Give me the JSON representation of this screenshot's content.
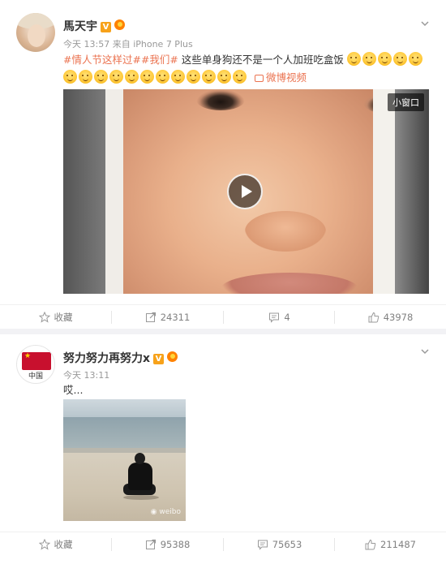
{
  "colors": {
    "topic": "#eb7350",
    "verified_badge": "#f7a21a",
    "meta_text": "#999999",
    "action_text": "#808080"
  },
  "posts": [
    {
      "author": "馬天宇",
      "verified_badge": "V",
      "meta": "今天 13:57 来自 iPhone 7 Plus",
      "topic1": "#情人节这样过#",
      "topic2": "#我们#",
      "text": "这些单身狗还不是一个人加班吃盒饭",
      "video_link": "微博视频",
      "mini_window": "小窗口",
      "actions": {
        "favorite": "收藏",
        "repost_count": "24311",
        "comment_count": "4",
        "like_count": "43978"
      }
    },
    {
      "author": "努力努力再努力x",
      "verified_badge": "V",
      "avatar_text": "中国",
      "meta": "今天 13:11",
      "text": "哎...",
      "actions": {
        "favorite": "收藏",
        "repost_count": "95388",
        "comment_count": "75653",
        "like_count": "211487"
      }
    }
  ]
}
